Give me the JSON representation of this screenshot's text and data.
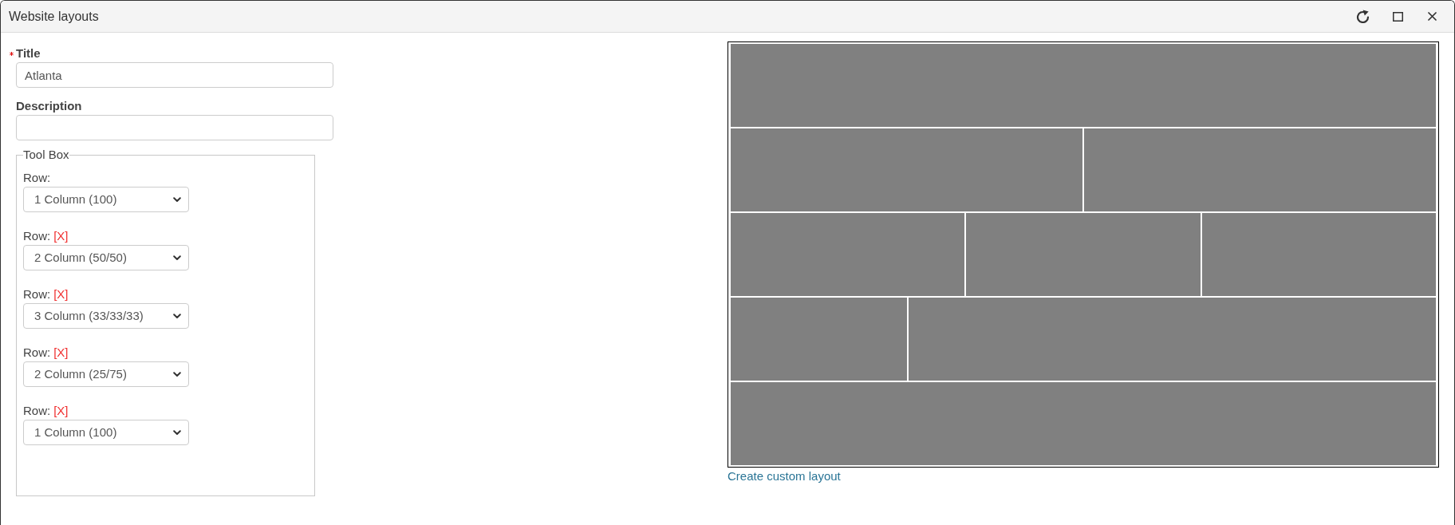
{
  "window": {
    "title": "Website layouts"
  },
  "fields": [
    {
      "label": "Title",
      "required": true,
      "value": "Atlanta"
    },
    {
      "label": "Description",
      "required": false
    }
  ],
  "toolbox": {
    "legend": "Tool Box",
    "rows": [
      {
        "label": "Row:",
        "value": "1 Column (100)"
      },
      {
        "label": "Row:",
        "remove": "[X]",
        "value": "2 Column (50/50)"
      },
      {
        "label": "Row:",
        "remove": "[X]",
        "value": "3 Column (33/33/33)"
      },
      {
        "label": "Row:",
        "remove": "[X]",
        "value": "2 Column (25/75)"
      },
      {
        "label": "Row:",
        "remove": "[X]",
        "value": "1 Column (100)"
      }
    ]
  },
  "preview": {
    "rows": [
      {
        "cells": [
          {
            "kind": "full"
          }
        ]
      },
      {
        "cells": [
          {
            "kind": "half"
          },
          {
            "kind": "half"
          }
        ]
      },
      {
        "cells": [
          {
            "kind": "third"
          },
          {
            "kind": "third"
          },
          {
            "kind": "third"
          }
        ]
      },
      {
        "cells": [
          {
            "kind": "quarter"
          },
          {
            "kind": "three_quarters"
          }
        ]
      },
      {
        "cells": [
          {
            "kind": "full"
          }
        ]
      }
    ],
    "link": "Create custom layout"
  }
}
